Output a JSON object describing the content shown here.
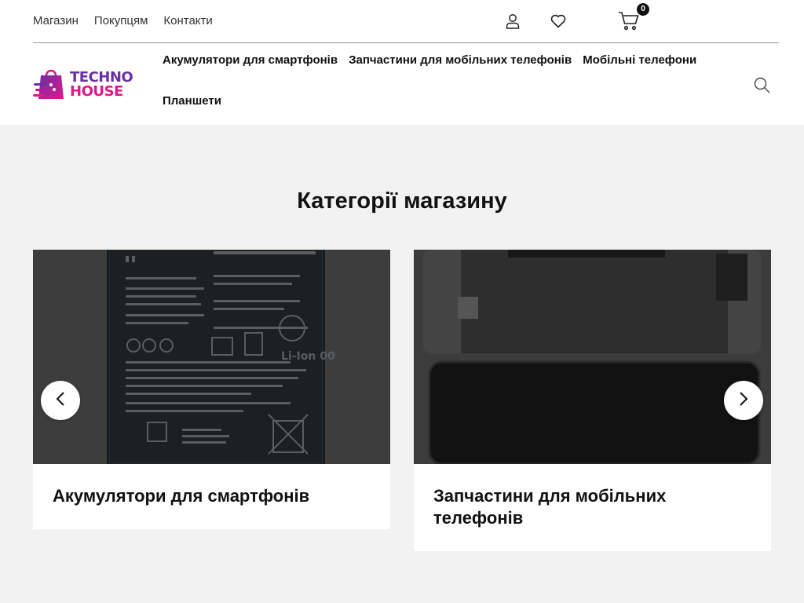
{
  "topbar": {
    "links": [
      "Магазин",
      "Покупцям",
      "Контакти"
    ],
    "cart_count": "0",
    "icons": [
      "user-icon",
      "heart-icon",
      "cart-icon"
    ]
  },
  "logo": {
    "line1": "TECHNO",
    "line2": "HOUSE"
  },
  "nav": {
    "items": [
      "Акумулятори для смартфонів",
      "Запчастини для мобільних телефонів",
      "Мобільні телефони",
      "Планшети"
    ]
  },
  "section": {
    "title": "Категорії магазину",
    "cards": [
      {
        "title": "Акумулятори для смартфонів"
      },
      {
        "title": "Запчастини для мобільних телефонів"
      }
    ]
  },
  "colors": {
    "logo_purple": "#6b2fa6",
    "logo_pink": "#e0188a",
    "page_bg": "#f2f2f2",
    "image_overlay": "#3a3a3a"
  }
}
